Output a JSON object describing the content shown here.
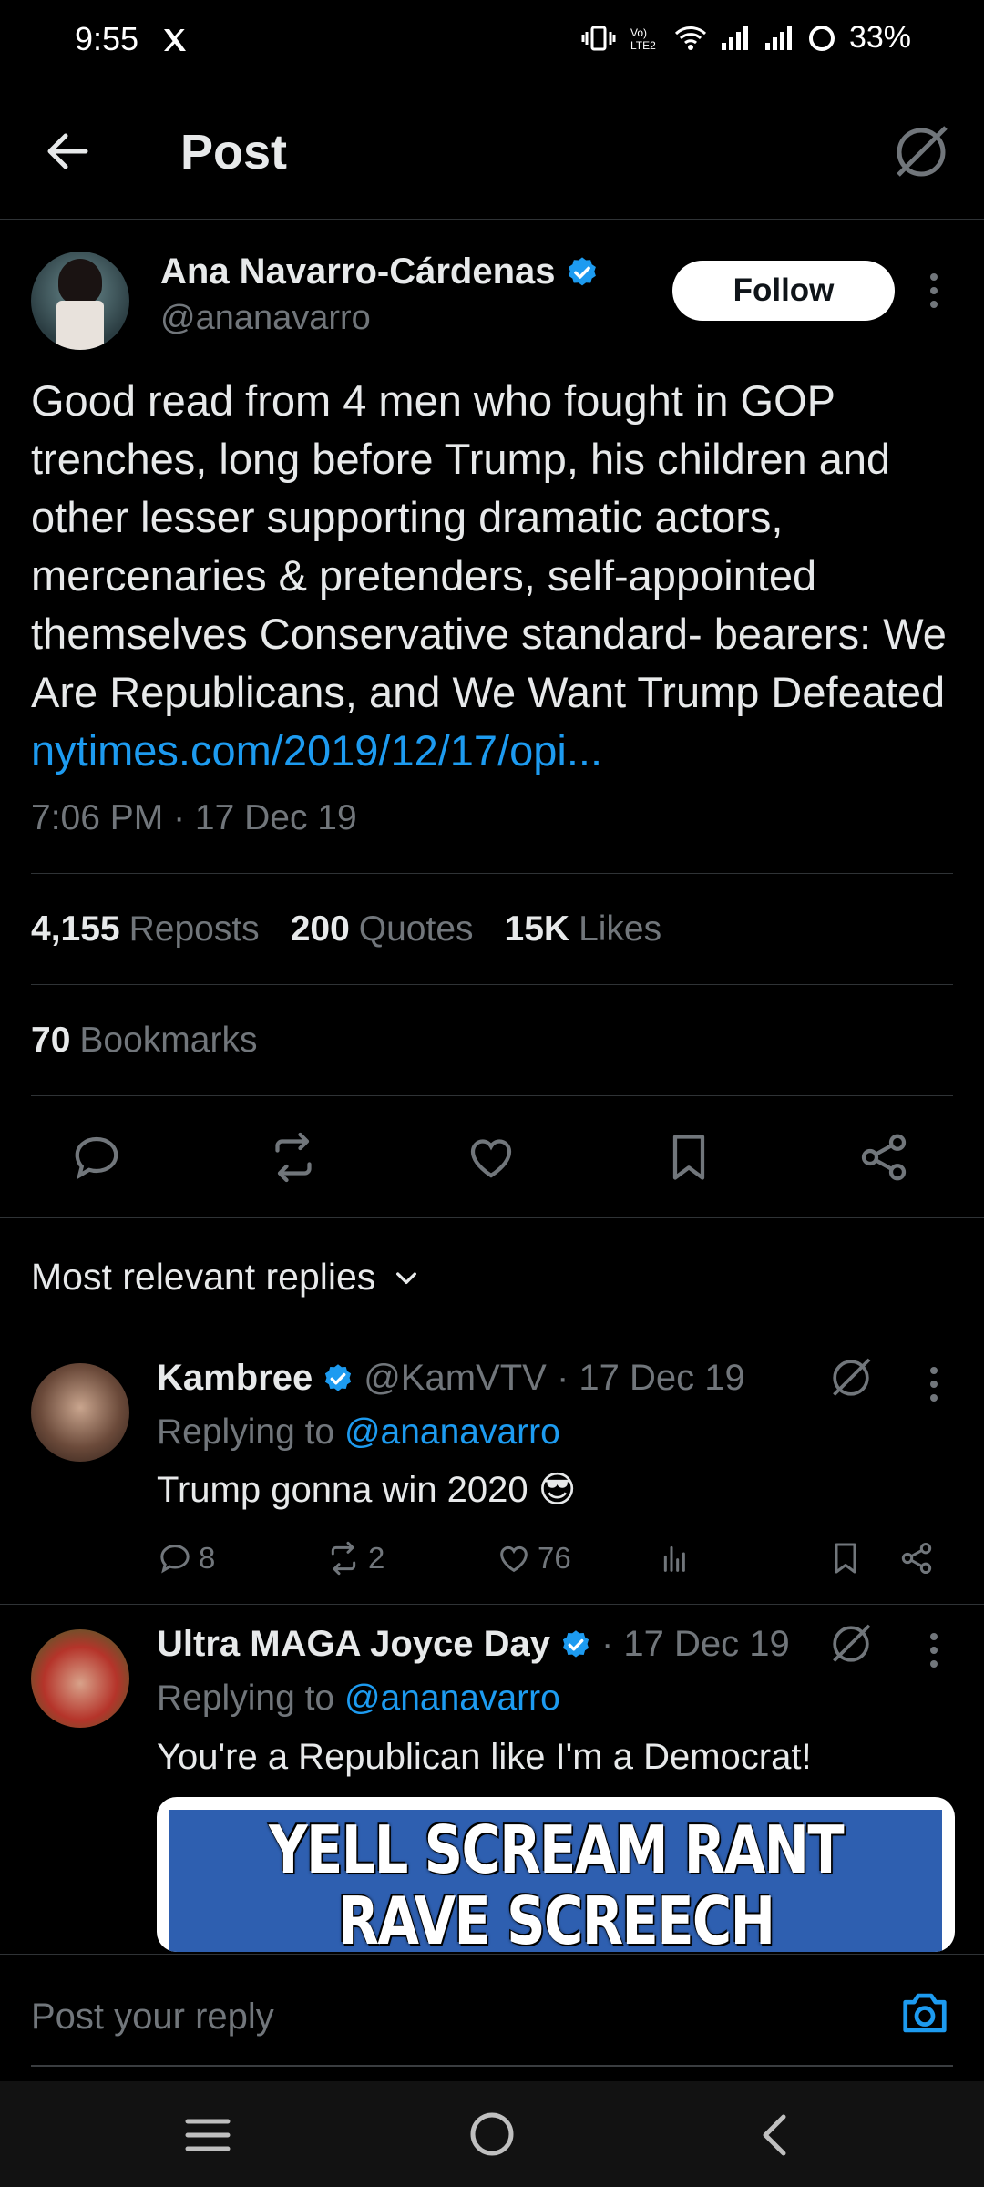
{
  "status_bar": {
    "time": "9:55",
    "battery": "33%"
  },
  "header": {
    "title": "Post"
  },
  "post": {
    "author_name": "Ana Navarro-Cárdenas",
    "author_handle": "@ananavarro",
    "follow_label": "Follow",
    "text": "Good read from 4 men who fought in GOP trenches, long before Trump, his children and other lesser supporting dramatic actors, mercenaries & pretenders, self-appointed themselves Conservative standard- bearers: We Are Republicans, and We Want Trump Defeated ",
    "link": "nytimes.com/2019/12/17/opi...",
    "timestamp": "7:06 PM · 17 Dec 19",
    "reposts_count": "4,155",
    "reposts_label": "Reposts",
    "quotes_count": "200",
    "quotes_label": "Quotes",
    "likes_count": "15K",
    "likes_label": "Likes",
    "bookmarks_count": "70",
    "bookmarks_label": "Bookmarks"
  },
  "replies_header": "Most relevant replies",
  "replies": [
    {
      "name": "Kambree",
      "handle_date": "@KamVTV · 17 Dec 19",
      "replying_prefix": "Replying to ",
      "replying_to": "@ananavarro",
      "text": "Trump gonna win 2020 😎",
      "comments": "8",
      "reposts": "2",
      "likes": "76"
    },
    {
      "name": "Ultra MAGA Joyce Day",
      "handle_date": "· 17 Dec 19",
      "replying_prefix": "Replying to ",
      "replying_to": "@ananavarro",
      "text": "You're a Republican like I'm a Democrat!",
      "meme_line1": "YELL SCREAM RANT",
      "meme_line2": "RAVE SCREECH HOLLER"
    }
  ],
  "compose": {
    "placeholder": "Post your reply"
  },
  "colors": {
    "background": "#000000",
    "accent": "#1d9bf0",
    "muted": "#71767b",
    "text": "#e7e9ea",
    "divider": "#2f3336"
  },
  "icons": [
    "x-logo-icon",
    "back-arrow-icon",
    "grok-icon",
    "verified-badge-icon",
    "more-icon",
    "reply-icon",
    "repost-icon",
    "like-icon",
    "bookmark-icon",
    "share-icon",
    "chevron-down-icon",
    "views-icon",
    "camera-icon",
    "menu-icon",
    "home-circle-icon",
    "back-chevron-icon"
  ]
}
